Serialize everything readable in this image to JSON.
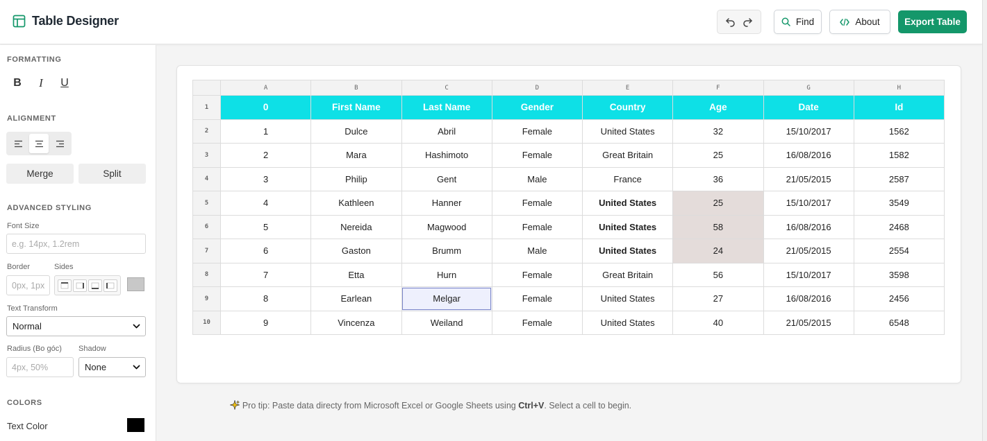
{
  "app": {
    "title": "Table Designer"
  },
  "toolbar": {
    "find": "Find",
    "about": "About",
    "export": "Export Table"
  },
  "sidebar": {
    "formatting": {
      "title": "FORMATTING",
      "bold": "B",
      "italic": "I",
      "underline": "U"
    },
    "alignment": {
      "title": "ALIGNMENT",
      "active": "center",
      "merge": "Merge",
      "split": "Split"
    },
    "advanced": {
      "title": "ADVANCED STYLING",
      "font_size_label": "Font Size",
      "font_size_placeholder": "e.g. 14px, 1.2rem",
      "border_label": "Border",
      "border_placeholder": "0px, 1px",
      "sides_label": "Sides",
      "border_color": "#c8c8c8",
      "text_transform_label": "Text Transform",
      "text_transform_value": "Normal",
      "radius_label": "Radius (Bo góc)",
      "radius_placeholder": "4px, 50%",
      "shadow_label": "Shadow",
      "shadow_value": "None"
    },
    "colors": {
      "title": "COLORS",
      "text_color_label": "Text Color",
      "text_color": "#000000"
    }
  },
  "table": {
    "columns": [
      "A",
      "B",
      "C",
      "D",
      "E",
      "F",
      "G",
      "H"
    ],
    "header_color": "#0ee0e6",
    "rows": [
      [
        "0",
        "First Name",
        "Last Name",
        "Gender",
        "Country",
        "Age",
        "Date",
        "Id"
      ],
      [
        "1",
        "Dulce",
        "Abril",
        "Female",
        "United States",
        "32",
        "15/10/2017",
        "1562"
      ],
      [
        "2",
        "Mara",
        "Hashimoto",
        "Female",
        "Great Britain",
        "25",
        "16/08/2016",
        "1582"
      ],
      [
        "3",
        "Philip",
        "Gent",
        "Male",
        "France",
        "36",
        "21/05/2015",
        "2587"
      ],
      [
        "4",
        "Kathleen",
        "Hanner",
        "Female",
        "United States",
        "25",
        "15/10/2017",
        "3549"
      ],
      [
        "5",
        "Nereida",
        "Magwood",
        "Female",
        "United States",
        "58",
        "16/08/2016",
        "2468"
      ],
      [
        "6",
        "Gaston",
        "Brumm",
        "Male",
        "United States",
        "24",
        "21/05/2015",
        "2554"
      ],
      [
        "7",
        "Etta",
        "Hurn",
        "Female",
        "Great Britain",
        "56",
        "15/10/2017",
        "3598"
      ],
      [
        "8",
        "Earlean",
        "Melgar",
        "Female",
        "United States",
        "27",
        "16/08/2016",
        "2456"
      ],
      [
        "9",
        "Vincenza",
        "Weiland",
        "Female",
        "United States",
        "40",
        "21/05/2015",
        "6548"
      ]
    ],
    "bold_cells": [
      [
        4,
        4
      ],
      [
        5,
        4
      ],
      [
        6,
        4
      ]
    ],
    "shaded_cells": [
      [
        4,
        5
      ],
      [
        5,
        5
      ],
      [
        6,
        5
      ]
    ],
    "selected_cell": [
      8,
      2
    ]
  },
  "tip": {
    "prefix": "Pro tip: Paste data directy from Microsoft Excel or Google Sheets using ",
    "shortcut": "Ctrl+V",
    "suffix": ". Select a cell to begin."
  }
}
